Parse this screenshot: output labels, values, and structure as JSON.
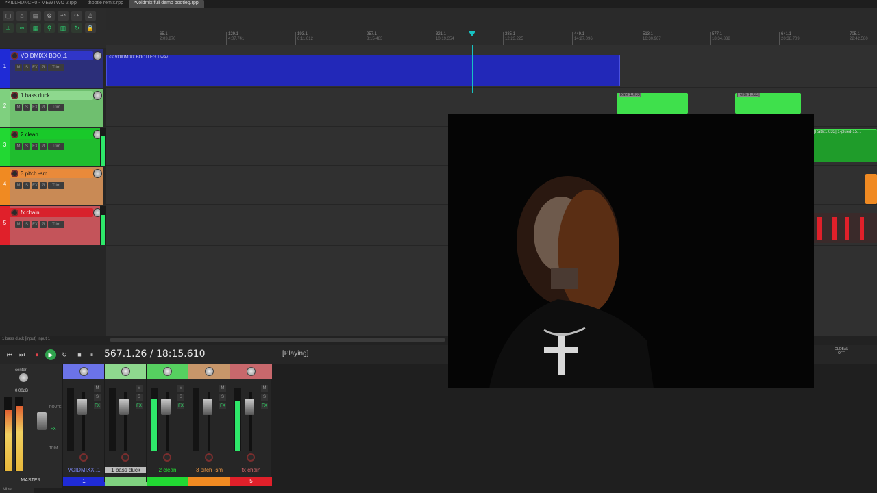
{
  "project_tabs": [
    {
      "label": "*KILLHUNCH0 - MEWTWO 2.rpp",
      "active": false
    },
    {
      "label": "thootie remix.rpp",
      "active": false
    },
    {
      "label": "*voidmix full demo bootleg.rpp",
      "active": true
    }
  ],
  "ruler": {
    "ticks": [
      {
        "bar": "65.1",
        "time": "2:03.870"
      },
      {
        "bar": "129.1",
        "time": "4:07.741"
      },
      {
        "bar": "193.1",
        "time": "6:11.612"
      },
      {
        "bar": "257.1",
        "time": "8:15.483"
      },
      {
        "bar": "321.1",
        "time": "10:19.354"
      },
      {
        "bar": "385.1",
        "time": "12:23.225"
      },
      {
        "bar": "449.1",
        "time": "14:27.096"
      },
      {
        "bar": "513.1",
        "time": "16:30.967"
      },
      {
        "bar": "577.1",
        "time": "18:34.838"
      },
      {
        "bar": "641.1",
        "time": "20:38.709"
      },
      {
        "bar": "705.1",
        "time": "22:42.580"
      }
    ]
  },
  "tracks": [
    {
      "number": "1",
      "name": "VOIDMIXX BOO..1",
      "color": "#1f2bd6",
      "bg": "#3036c8",
      "text": "#e8e8ff"
    },
    {
      "number": "2",
      "name": "1 bass duck",
      "color": "#8ed88e",
      "bg": "#7fd07f",
      "text": "#1b1b1b"
    },
    {
      "number": "3",
      "name": "2 clean",
      "color": "#22d833",
      "bg": "#19c92a",
      "text": "#0b0b0b"
    },
    {
      "number": "4",
      "name": "3 pitch -sm",
      "color": "#f08a22",
      "bg": "#e98a3a",
      "text": "#1b1b1b"
    },
    {
      "number": "5",
      "name": "fx chain",
      "color": "#e0202a",
      "bg": "#d8222c",
      "text": "#f4f4f4"
    }
  ],
  "track_buttons": {
    "mute": "M",
    "solo": "S",
    "fx": "FX",
    "phase": "Ø",
    "trim": "Trim"
  },
  "items": {
    "track1_item": "<< VOIDMIXX BOOTLEG 1.wav",
    "rate_label": "[Rate:1.033]",
    "glued_label": "[Rate:1.033] 1-glued-15..."
  },
  "status_line": "1 bass duck [input] Input 1",
  "transport": {
    "time": "567.1.26 / 18:15.610",
    "state": "[Playing]",
    "global_label": "GLOBAL",
    "off_label": "OFF"
  },
  "master": {
    "pan_label": "center",
    "db": "0.00dB",
    "label": "MASTER",
    "route": "ROUTE",
    "trim": "TRIM",
    "fx": "FX"
  },
  "mixer_strips": [
    {
      "name": "VOIDMIXX..1",
      "number": "1",
      "color": "#1f2bd6",
      "name_color": "#7b86f0",
      "level": 0.0
    },
    {
      "name": "1 bass duck",
      "number": "",
      "color": "#7fd07f",
      "name_color": "#1b1b1b",
      "level": 0.0
    },
    {
      "name": "2 clean",
      "number": "",
      "color": "#22d833",
      "name_color": "#22e833",
      "level": 0.82
    },
    {
      "name": "3 pitch -sm",
      "number": "",
      "color": "#f08a22",
      "name_color": "#f39a45",
      "level": 0.0
    },
    {
      "name": "fx chain",
      "number": "5",
      "color": "#e0202a",
      "name_color": "#e86a70",
      "level": 0.78
    }
  ],
  "mixer_tab": "Mixer",
  "accent": "#17c2c2"
}
